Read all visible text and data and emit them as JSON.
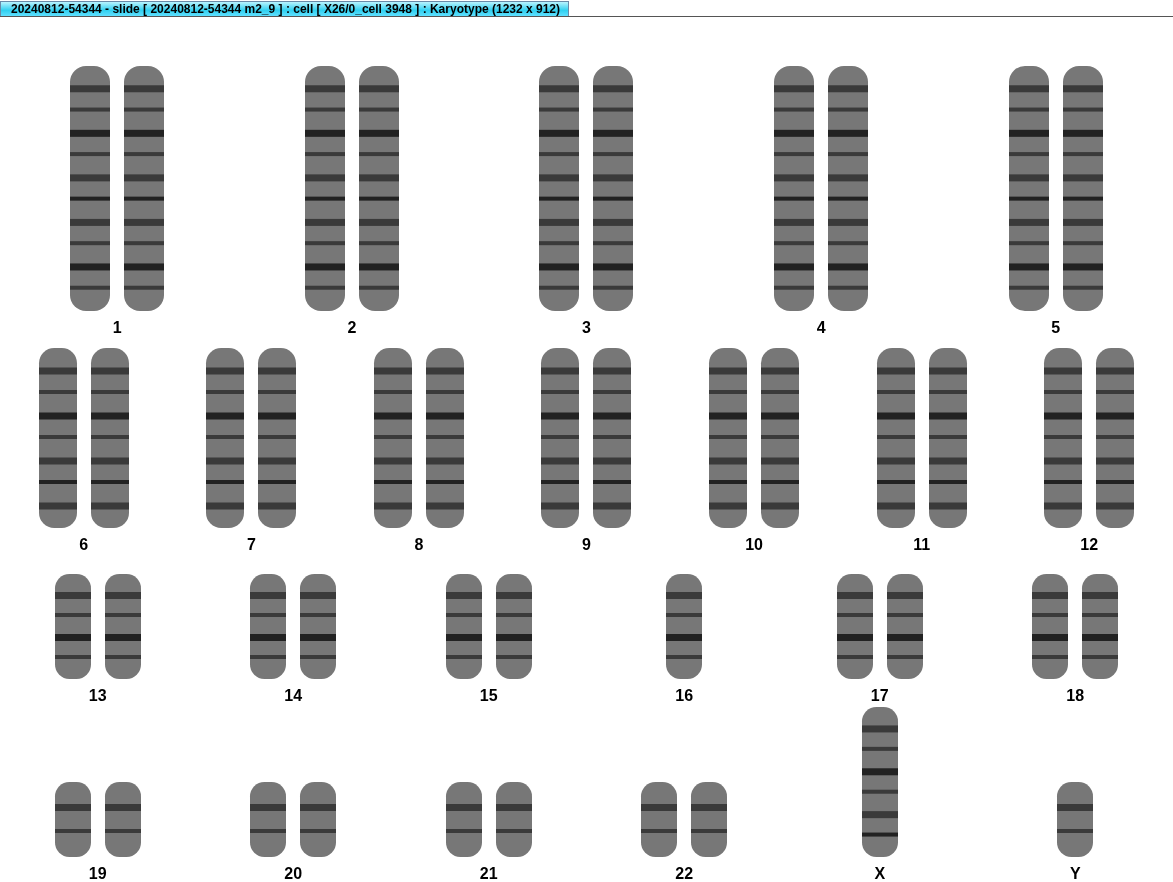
{
  "window": {
    "title": "20240812-54344 - slide [ 20240812-54344 m2_9 ] : cell [ X26/0_cell 3948 ] : Karyotype  (1232 x 912)"
  },
  "rows": [
    {
      "chromosomes": [
        {
          "label": "1",
          "kind": "pair"
        },
        {
          "label": "2",
          "kind": "pair"
        },
        {
          "label": "3",
          "kind": "pair"
        },
        {
          "label": "4",
          "kind": "pair"
        },
        {
          "label": "5",
          "kind": "pair"
        }
      ]
    },
    {
      "chromosomes": [
        {
          "label": "6",
          "kind": "pair"
        },
        {
          "label": "7",
          "kind": "pair"
        },
        {
          "label": "8",
          "kind": "pair"
        },
        {
          "label": "9",
          "kind": "pair"
        },
        {
          "label": "10",
          "kind": "pair"
        },
        {
          "label": "11",
          "kind": "pair"
        },
        {
          "label": "12",
          "kind": "pair"
        }
      ]
    },
    {
      "chromosomes": [
        {
          "label": "13",
          "kind": "pair"
        },
        {
          "label": "14",
          "kind": "pair"
        },
        {
          "label": "15",
          "kind": "pair"
        },
        {
          "label": "16",
          "kind": "single"
        },
        {
          "label": "17",
          "kind": "pair"
        },
        {
          "label": "18",
          "kind": "pair"
        }
      ]
    },
    {
      "chromosomes": [
        {
          "label": "19",
          "kind": "pair"
        },
        {
          "label": "20",
          "kind": "pair"
        },
        {
          "label": "21",
          "kind": "pair"
        },
        {
          "label": "22",
          "kind": "pair"
        },
        {
          "label": "X",
          "kind": "long"
        },
        {
          "label": "Y",
          "kind": "single"
        }
      ]
    }
  ]
}
